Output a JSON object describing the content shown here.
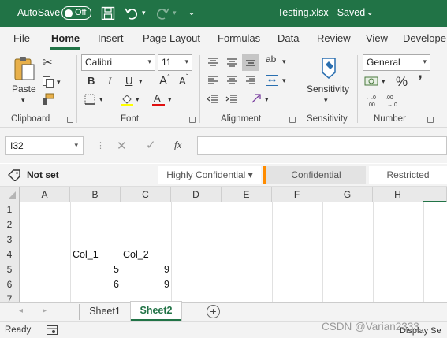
{
  "titlebar": {
    "autosave_label": "AutoSave",
    "autosave_state": "Off",
    "file_title": "Testing.xlsx  -  Saved",
    "title_arrow": "⌄"
  },
  "tabs": [
    "File",
    "Home",
    "Insert",
    "Page Layout",
    "Formulas",
    "Data",
    "Review",
    "View",
    "Develope"
  ],
  "ribbon": {
    "clipboard": {
      "paste_label": "Paste",
      "group_label": "Clipboard"
    },
    "font": {
      "font_name": "Calibri",
      "font_size": "11",
      "bold": "B",
      "italic": "I",
      "underline": "U",
      "grow": "A",
      "shrink": "A",
      "group_label": "Font"
    },
    "alignment": {
      "group_label": "Alignment"
    },
    "sensitivity": {
      "label": "Sensitivity",
      "group_label": "Sensitivity"
    },
    "number": {
      "format": "General",
      "percent": "%",
      "comma": "❜",
      "group_label": "Number"
    },
    "accent_color": "#217346"
  },
  "formula_bar": {
    "name_box": "I32",
    "fx": "fx",
    "formula": ""
  },
  "sensitivity_bar": {
    "tag_label": "Not set",
    "options": [
      "Highly Confidential ▾",
      "Confidential",
      "Restricted"
    ]
  },
  "grid": {
    "columns": [
      "A",
      "B",
      "C",
      "D",
      "E",
      "F",
      "G",
      "H"
    ],
    "rows": [
      "1",
      "2",
      "3",
      "4",
      "5",
      "6",
      "7"
    ],
    "cells": {
      "B4": "Col_1",
      "C4": "Col_2",
      "B5": "5",
      "C5": "9",
      "B6": "6",
      "C6": "9"
    }
  },
  "sheet_tabs": {
    "sheets": [
      "Sheet1",
      "Sheet2"
    ],
    "active": "Sheet2",
    "add": "+"
  },
  "status": {
    "ready": "Ready",
    "display": "Display Se",
    "watermark": "CSDN @Varian2333"
  }
}
